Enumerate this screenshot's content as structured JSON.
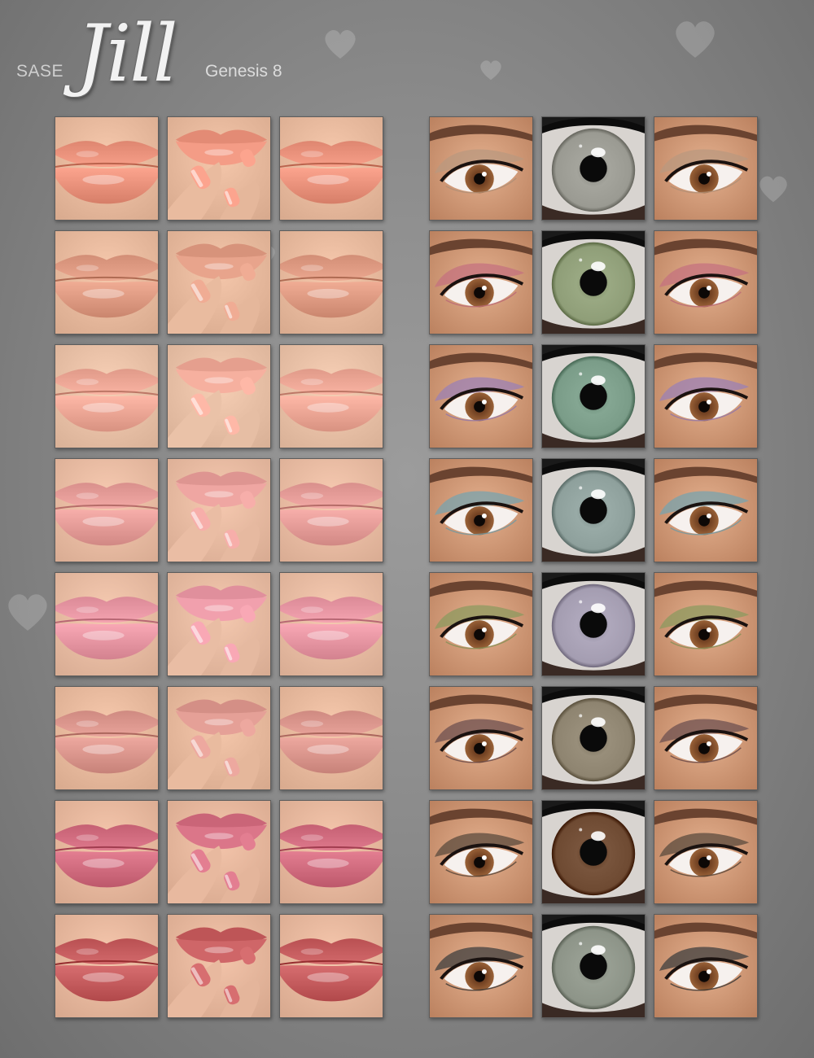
{
  "title": {
    "brand": "SASE",
    "name": "Jill",
    "subtitle": "Genesis 8"
  },
  "lip_swatches": [
    {
      "row": 1,
      "lip": "#e8907a",
      "skin": "#efc1a5"
    },
    {
      "row": 2,
      "lip": "#dc9880",
      "skin": "#efc1a5"
    },
    {
      "row": 3,
      "lip": "#eaa493",
      "skin": "#f0c8ae"
    },
    {
      "row": 4,
      "lip": "#e39a96",
      "skin": "#f0c3aa"
    },
    {
      "row": 5,
      "lip": "#e594a1",
      "skin": "#efc3aa"
    },
    {
      "row": 6,
      "lip": "#d9948b",
      "skin": "#efc1a5"
    },
    {
      "row": 7,
      "lip": "#cf6a7d",
      "skin": "#eebfa5"
    },
    {
      "row": 8,
      "lip": "#c35a5c",
      "skin": "#eebfa5"
    }
  ],
  "eye_swatches": [
    {
      "row": 1,
      "shadow": "#b9987f",
      "iris": "#9a9a92"
    },
    {
      "row": 2,
      "shadow": "#c4727f",
      "iris": "#8f9e78"
    },
    {
      "row": 3,
      "shadow": "#9b80b4",
      "iris": "#7a9c88"
    },
    {
      "row": 4,
      "shadow": "#78a3ad",
      "iris": "#8ea09c"
    },
    {
      "row": 5,
      "shadow": "#8c9a5f",
      "iris": "#a49db1"
    },
    {
      "row": 6,
      "shadow": "#6e5050",
      "iris": "#8e8470"
    },
    {
      "row": 7,
      "shadow": "#5b4b3e",
      "iris": "#6e4a32"
    },
    {
      "row": 8,
      "shadow": "#3f3f3f",
      "iris": "#8d9488"
    }
  ]
}
